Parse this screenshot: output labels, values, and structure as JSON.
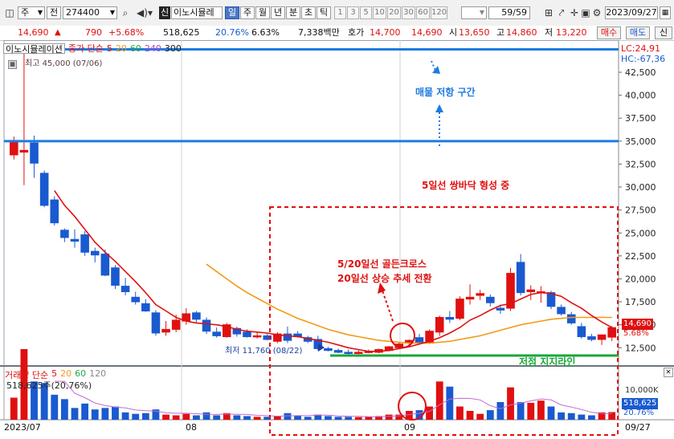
{
  "toolbar": {
    "market_select": "주",
    "prev_label": "전",
    "code": "274400",
    "credit_badge": "신",
    "stock_name": "이노시뮬레",
    "periods": [
      "일",
      "주",
      "월",
      "년",
      "분",
      "초",
      "틱"
    ],
    "active_period": "일",
    "intervals": [
      "1",
      "3",
      "5",
      "10",
      "20",
      "30",
      "60",
      "120"
    ],
    "range": "59/59",
    "date": "2023/09/27"
  },
  "quote": {
    "price": "14,690",
    "change_arrow": "▲",
    "change": "790",
    "change_pct": "+5.68%",
    "volume": "518,625",
    "volume_ratio": "20.76%",
    "turnover": "6.63%",
    "trade_value": "7,338백만",
    "ask_label": "호가",
    "ask_value": "14,700",
    "ask_value2": "14,690",
    "open_label": "시",
    "open_value": "13,650",
    "high_label": "고",
    "high_value": "14,860",
    "low_label": "저",
    "low_value": "13,220",
    "buy_label": "매수",
    "sell_label": "매도",
    "new_label": "신"
  },
  "legend": {
    "stock_name": "이노시뮬레이션",
    "price_title": "종가 단순",
    "ma": [
      "5",
      "20",
      "60",
      "240",
      "300"
    ],
    "high_info": "최고 45,000 (07/06)",
    "low_info": "최저 11,760 (08/22)",
    "lc": "LC:24,91",
    "hc": "HC:-67,36",
    "volume_title": "거래량 단순",
    "vol_ma": [
      "5",
      "20",
      "60",
      "120"
    ],
    "volume_info": "518,625주(20,76%)"
  },
  "annotations": {
    "resistance": "매물 저항 구간",
    "double_bottom": "5일선 쌍바닥 형성 중",
    "golden_cross_1": "5/20일선 골든크로스",
    "golden_cross_2": "20일선 상승 추세 전환",
    "support": "저점 지지라인"
  },
  "y_ticks": [
    "42,500",
    "40,000",
    "37,500",
    "35,000",
    "32,500",
    "30,000",
    "27,500",
    "25,000",
    "22,500",
    "20,000",
    "17,500",
    "15,000",
    "12,500"
  ],
  "price_tag": "14,690",
  "pct_tag": "5.68%",
  "vol_axis": {
    "tick": "10,000K",
    "volume_tag": "518,625",
    "pct_tag": "20.76%"
  },
  "x_labels": {
    "start": "2023/07",
    "aug": "08",
    "sep": "09",
    "end": "09/27"
  },
  "colors": {
    "up": "#e01010",
    "down": "#1a5ad0",
    "ma5": "#e01010",
    "ma20": "#f39a16",
    "line": "#1e7be0",
    "support": "#18a83a"
  },
  "chart_data": {
    "type": "candlestick",
    "axis": {
      "ylim": [
        10600,
        46000
      ]
    },
    "candles": [
      {
        "d": "07/05",
        "o": 33500,
        "h": 35500,
        "l": 33000,
        "c": 35000
      },
      {
        "d": "07/06",
        "o": 33800,
        "h": 45000,
        "l": 30200,
        "c": 34000
      },
      {
        "d": "07/07",
        "o": 34800,
        "h": 35600,
        "l": 31000,
        "c": 32600
      },
      {
        "d": "07/10",
        "o": 31500,
        "h": 31800,
        "l": 27800,
        "c": 28000
      },
      {
        "d": "07/11",
        "o": 28600,
        "h": 29000,
        "l": 25800,
        "c": 26100
      },
      {
        "d": "07/12",
        "o": 25300,
        "h": 25500,
        "l": 24000,
        "c": 24500
      },
      {
        "d": "07/13",
        "o": 24300,
        "h": 25400,
        "l": 23400,
        "c": 24100
      },
      {
        "d": "07/14",
        "o": 24800,
        "h": 25200,
        "l": 22500,
        "c": 22900
      },
      {
        "d": "07/17",
        "o": 23000,
        "h": 23400,
        "l": 21800,
        "c": 22600
      },
      {
        "d": "07/18",
        "o": 22700,
        "h": 23200,
        "l": 20300,
        "c": 20400
      },
      {
        "d": "07/19",
        "o": 21200,
        "h": 21500,
        "l": 18900,
        "c": 19300
      },
      {
        "d": "07/20",
        "o": 19200,
        "h": 20100,
        "l": 18200,
        "c": 18600
      },
      {
        "d": "07/21",
        "o": 18000,
        "h": 18600,
        "l": 17200,
        "c": 17500
      },
      {
        "d": "07/24",
        "o": 17300,
        "h": 17800,
        "l": 16400,
        "c": 16500
      },
      {
        "d": "07/25",
        "o": 16300,
        "h": 16600,
        "l": 13800,
        "c": 14100
      },
      {
        "d": "07/26",
        "o": 14200,
        "h": 15400,
        "l": 13800,
        "c": 14500
      },
      {
        "d": "07/27",
        "o": 14500,
        "h": 16100,
        "l": 14200,
        "c": 15500
      },
      {
        "d": "07/28",
        "o": 15400,
        "h": 16800,
        "l": 15000,
        "c": 16200
      },
      {
        "d": "07/31",
        "o": 16300,
        "h": 16500,
        "l": 15200,
        "c": 15600
      },
      {
        "d": "08/01",
        "o": 15500,
        "h": 15800,
        "l": 14000,
        "c": 14300
      },
      {
        "d": "08/02",
        "o": 14200,
        "h": 14700,
        "l": 13600,
        "c": 13800
      },
      {
        "d": "08/03",
        "o": 13700,
        "h": 15200,
        "l": 13600,
        "c": 15000
      },
      {
        "d": "08/04",
        "o": 14600,
        "h": 14800,
        "l": 13700,
        "c": 14000
      },
      {
        "d": "08/07",
        "o": 14200,
        "h": 14500,
        "l": 13600,
        "c": 13700
      },
      {
        "d": "08/08",
        "o": 13800,
        "h": 14200,
        "l": 13500,
        "c": 13800
      },
      {
        "d": "08/09",
        "o": 13800,
        "h": 14000,
        "l": 13300,
        "c": 13400
      },
      {
        "d": "08/10",
        "o": 13200,
        "h": 14200,
        "l": 13000,
        "c": 14000
      },
      {
        "d": "08/11",
        "o": 14000,
        "h": 14800,
        "l": 13000,
        "c": 13300
      },
      {
        "d": "08/14",
        "o": 14000,
        "h": 14300,
        "l": 13600,
        "c": 13700
      },
      {
        "d": "08/16",
        "o": 13600,
        "h": 13800,
        "l": 13000,
        "c": 13200
      },
      {
        "d": "08/17",
        "o": 13400,
        "h": 13800,
        "l": 12200,
        "c": 12400
      },
      {
        "d": "08/18",
        "o": 12400,
        "h": 12600,
        "l": 12100,
        "c": 12200
      },
      {
        "d": "08/21",
        "o": 12200,
        "h": 12400,
        "l": 11900,
        "c": 12000
      },
      {
        "d": "08/22",
        "o": 12000,
        "h": 12300,
        "l": 11760,
        "c": 11900
      },
      {
        "d": "08/23",
        "o": 11900,
        "h": 12200,
        "l": 11800,
        "c": 12000
      },
      {
        "d": "08/24",
        "o": 12000,
        "h": 12300,
        "l": 11900,
        "c": 12100
      },
      {
        "d": "08/25",
        "o": 12000,
        "h": 12400,
        "l": 11900,
        "c": 12300
      },
      {
        "d": "08/28",
        "o": 12200,
        "h": 12700,
        "l": 12100,
        "c": 12600
      },
      {
        "d": "08/29",
        "o": 12500,
        "h": 13100,
        "l": 12400,
        "c": 12900
      },
      {
        "d": "08/30",
        "o": 13000,
        "h": 13400,
        "l": 12600,
        "c": 13300
      },
      {
        "d": "08/31",
        "o": 13600,
        "h": 14000,
        "l": 12900,
        "c": 13100
      },
      {
        "d": "09/01",
        "o": 13000,
        "h": 14500,
        "l": 12900,
        "c": 14300
      },
      {
        "d": "09/04",
        "o": 14200,
        "h": 16000,
        "l": 13800,
        "c": 15800
      },
      {
        "d": "09/05",
        "o": 15800,
        "h": 16500,
        "l": 15200,
        "c": 15600
      },
      {
        "d": "09/06",
        "o": 15700,
        "h": 18100,
        "l": 15500,
        "c": 17800
      },
      {
        "d": "09/07",
        "o": 17800,
        "h": 19400,
        "l": 17200,
        "c": 18000
      },
      {
        "d": "09/08",
        "o": 18200,
        "h": 18800,
        "l": 17700,
        "c": 18400
      },
      {
        "d": "09/11",
        "o": 18000,
        "h": 18300,
        "l": 17000,
        "c": 17400
      },
      {
        "d": "09/12",
        "o": 16800,
        "h": 17200,
        "l": 16200,
        "c": 16600
      },
      {
        "d": "09/13",
        "o": 16800,
        "h": 21200,
        "l": 16500,
        "c": 20600
      },
      {
        "d": "09/14",
        "o": 21800,
        "h": 22700,
        "l": 18200,
        "c": 18500
      },
      {
        "d": "09/15",
        "o": 18600,
        "h": 19300,
        "l": 17700,
        "c": 18800
      },
      {
        "d": "09/18",
        "o": 18500,
        "h": 19200,
        "l": 17400,
        "c": 18600
      },
      {
        "d": "09/19",
        "o": 18500,
        "h": 18700,
        "l": 16700,
        "c": 17000
      },
      {
        "d": "09/20",
        "o": 16900,
        "h": 17200,
        "l": 16000,
        "c": 16200
      },
      {
        "d": "09/21",
        "o": 16100,
        "h": 16400,
        "l": 15000,
        "c": 15200
      },
      {
        "d": "09/22",
        "o": 14800,
        "h": 15200,
        "l": 13500,
        "c": 13700
      },
      {
        "d": "09/25",
        "o": 13700,
        "h": 14000,
        "l": 13200,
        "c": 13400
      },
      {
        "d": "09/26",
        "o": 13400,
        "h": 13700,
        "l": 12800,
        "c": 13900
      },
      {
        "d": "09/27",
        "o": 13650,
        "h": 14860,
        "l": 13220,
        "c": 14690
      }
    ],
    "ma5": [
      null,
      null,
      null,
      null,
      29600,
      28000,
      26800,
      25400,
      24000,
      22900,
      21900,
      20800,
      19700,
      18500,
      17200,
      16500,
      15800,
      15400,
      15200,
      15100,
      15000,
      14800,
      14500,
      14300,
      14200,
      14100,
      13900,
      13800,
      13700,
      13500,
      13300,
      13100,
      12800,
      12500,
      12300,
      12100,
      12100,
      12200,
      12400,
      12600,
      12900,
      13200,
      13600,
      14100,
      14700,
      15500,
      16000,
      16600,
      17100,
      17300,
      17800,
      18300,
      18500,
      18400,
      18100,
      17400,
      16800,
      16000,
      15300,
      14700
    ],
    "ma20": [
      null,
      null,
      null,
      null,
      null,
      null,
      null,
      null,
      null,
      null,
      null,
      null,
      null,
      null,
      null,
      null,
      null,
      null,
      null,
      21600,
      20800,
      20000,
      19200,
      18500,
      17900,
      17300,
      16700,
      16200,
      15700,
      15300,
      14900,
      14500,
      14200,
      13900,
      13700,
      13500,
      13300,
      13200,
      13100,
      13000,
      13000,
      13000,
      13100,
      13200,
      13400,
      13600,
      13800,
      14100,
      14400,
      14700,
      15000,
      15200,
      15400,
      15600,
      15700,
      15800,
      15800,
      15800,
      15800,
      15800
    ],
    "volume": [
      1500,
      4800,
      2600,
      2500,
      1700,
      1400,
      800,
      1100,
      700,
      800,
      900,
      500,
      400,
      450,
      700,
      350,
      300,
      400,
      300,
      500,
      300,
      450,
      300,
      250,
      200,
      200,
      250,
      450,
      300,
      200,
      350,
      250,
      200,
      200,
      180,
      200,
      250,
      350,
      350,
      600,
      650,
      900,
      2600,
      2250,
      900,
      600,
      400,
      650,
      1200,
      2200,
      1200,
      1150,
      1300,
      900,
      500,
      450,
      350,
      300,
      500,
      518
    ]
  }
}
